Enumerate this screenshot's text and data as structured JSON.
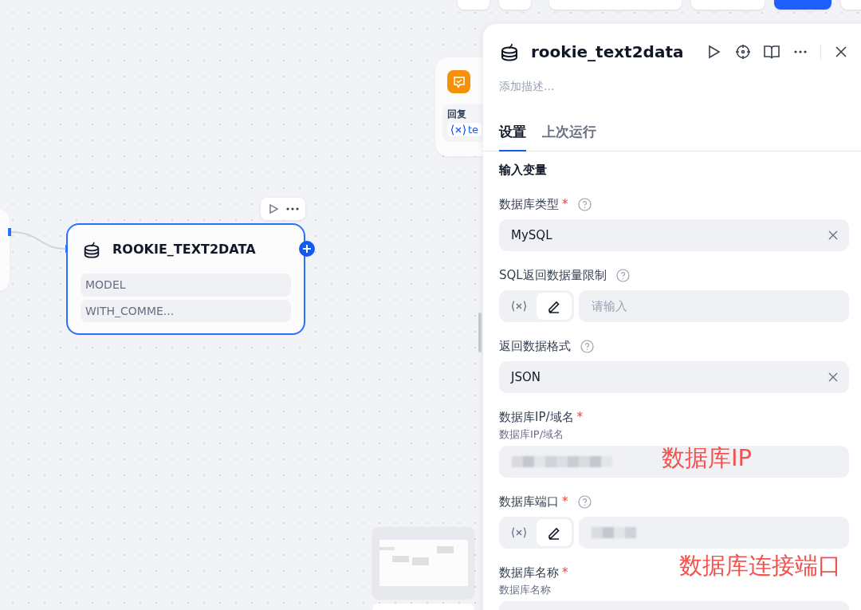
{
  "node": {
    "title": "ROOKIE_TEXT2DATA",
    "selected": true,
    "inputs": [
      "MODEL",
      "WITH_COMME..."
    ]
  },
  "reply_node": {
    "label": "回复",
    "variable": "te"
  },
  "panel": {
    "title": "rookie_text2data",
    "description_placeholder": "添加描述...",
    "tabs": [
      {
        "label": "设置",
        "selected": true
      },
      {
        "label": "上次运行",
        "selected": false
      }
    ],
    "section": "输入变量",
    "fields": [
      {
        "kind": "select",
        "label": "数据库类型",
        "required_mark": "*",
        "help": true,
        "value": "MySQL"
      },
      {
        "kind": "variable",
        "label": "SQL返回数据量限制",
        "help": true,
        "placeholder": "请输入",
        "value_hidden": false,
        "modes": [
          {
            "selected": false
          },
          {
            "selected": true
          }
        ]
      },
      {
        "kind": "select",
        "label": "返回数据格式",
        "help": true,
        "value": "JSON"
      },
      {
        "kind": "text",
        "label": "数据库IP/域名",
        "required_mark": "*",
        "help": false,
        "hint": "数据库IP/域名",
        "value_hidden": true
      },
      {
        "kind": "variable",
        "label": "数据库端口",
        "required_mark": "*",
        "help": true,
        "value_hidden": true,
        "modes": [
          {
            "selected": false
          },
          {
            "selected": true
          }
        ]
      },
      {
        "kind": "text",
        "label": "数据库名称",
        "required_mark": "*",
        "hint": "数据库名称"
      }
    ]
  },
  "annotations": [
    "数据库IP",
    "数据库连接端口"
  ]
}
